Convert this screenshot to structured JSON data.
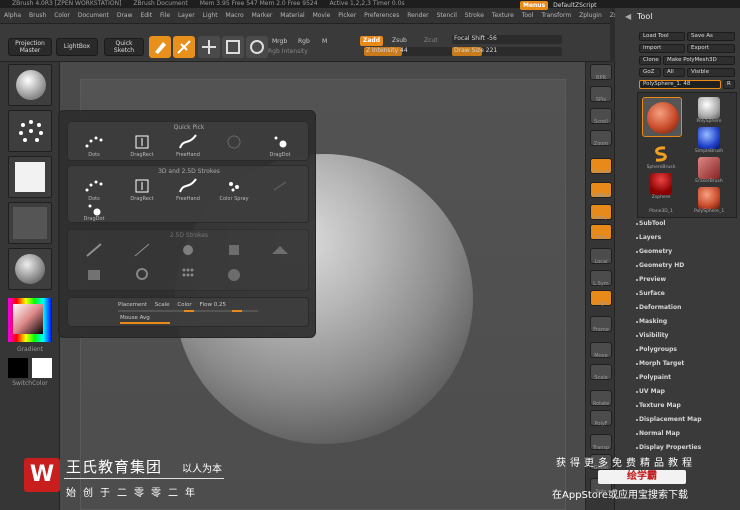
{
  "title": {
    "segments": [
      "ZBrush 4.0R3 [ZPEN WORKSTATION]",
      "ZBrush Document",
      "Mem 3.95 Free 547 Mem 2.0 Free 9524",
      "Active 1,2,2,3 Timer 0.0s"
    ]
  },
  "menubar": {
    "items": [
      "Alpha",
      "Brush",
      "Color",
      "Document",
      "Draw",
      "Edit",
      "File",
      "Layer",
      "Light",
      "Macro",
      "Marker",
      "Material",
      "Movie",
      "Picker",
      "Preferences",
      "Render",
      "Stencil",
      "Stroke",
      "Texture",
      "Tool",
      "Transform",
      "Zplugin",
      "Zscript"
    ],
    "menus_label": "Menus",
    "default_script": "DefaultZScript"
  },
  "toolbar": {
    "projection_master": "Projection Master",
    "lightbox": "LightBox",
    "quick_sketch": "Quick Sketch",
    "edit": "Edit",
    "draw": "Draw",
    "move": "Move",
    "scale": "Scale",
    "rotate": "Rotate",
    "mrgb": "Mrgb",
    "rgb": "Rgb",
    "m": "M",
    "rgb_intensity": "Rgb Intensity",
    "zadd": "Zadd",
    "zsub": "Zsub",
    "zcut": "Zcut",
    "focal_shift": "Focal Shift -56",
    "focal_shift_value": -56,
    "z_intensity": "Z Intensity 44",
    "z_intensity_value": 44,
    "draw_size": "Draw Size 221",
    "draw_size_value": 221
  },
  "leftshelf": {
    "gradient_label": "Gradient",
    "switchcolor_label": "SwitchColor"
  },
  "palette": {
    "quick_pick": {
      "title": "Quick Pick",
      "items": [
        "Dots",
        "DragRect",
        "FreeHand",
        "",
        "DragDot"
      ]
    },
    "three_d_strokes": {
      "title": "3D and 2.5D Strokes",
      "items": [
        "Dots",
        "DragRect",
        "FreeHand",
        "Color Spray",
        "",
        "DragDot"
      ]
    },
    "two_five_d": {
      "title": "2.5D Strokes"
    },
    "footer": {
      "placement": "Placement",
      "scale": "Scale",
      "color": "Color",
      "flow": "Flow 0.25",
      "flow_value": 0.25,
      "mouse_avg": "Mouse Avg"
    }
  },
  "rstrip": {
    "items": [
      "BPR",
      "SPix",
      "Scroll",
      "Zoom",
      "Actual",
      "AAHalf",
      "Persp",
      "Floor",
      "Local",
      "L.Sym",
      "Gxyz",
      "Frame",
      "Move",
      "Scale",
      "Rotate",
      "PolyF",
      "Transp",
      "Ghost",
      "Solo",
      "Xpose"
    ]
  },
  "toolpanel": {
    "title": "Tool",
    "load_tool": "Load Tool",
    "save_as": "Save As",
    "import": "Import",
    "export": "Export",
    "clone": "Clone",
    "make_polymesh": "Make PolyMesh3D",
    "goz": "GoZ",
    "all": "All",
    "visible": "Visible",
    "r_label": "R",
    "current_tool": "PolySphere_1. 48",
    "thumbs": [
      "PolySphere",
      "SimpleBrush",
      "SphereBrush",
      "EraserBrush",
      "Zsphere",
      "PolySphere_1",
      "Plane3D_1"
    ],
    "subpalettes": [
      "SubTool",
      "Layers",
      "Geometry",
      "Geometry HD",
      "Preview",
      "Surface",
      "Deformation",
      "Masking",
      "Visibility",
      "Polygroups",
      "Morph Target",
      "Polypaint",
      "UV Map",
      "Texture Map",
      "Displacement Map",
      "Normal Map",
      "Display Properties"
    ]
  },
  "watermark": {
    "logo": "W",
    "company": "王氏教育集团",
    "slogan": "以人为本",
    "since": "始创于二零零二年",
    "promo1": "获得更多免费精品教程",
    "site": "绘学霸",
    "promo2": "在AppStore或应用宝搜索下载"
  },
  "colors": {
    "accent": "#e88a1a",
    "panel": "#3a3a3a",
    "canvas": "#4a4a4a",
    "logo_red": "#c81e1e"
  }
}
